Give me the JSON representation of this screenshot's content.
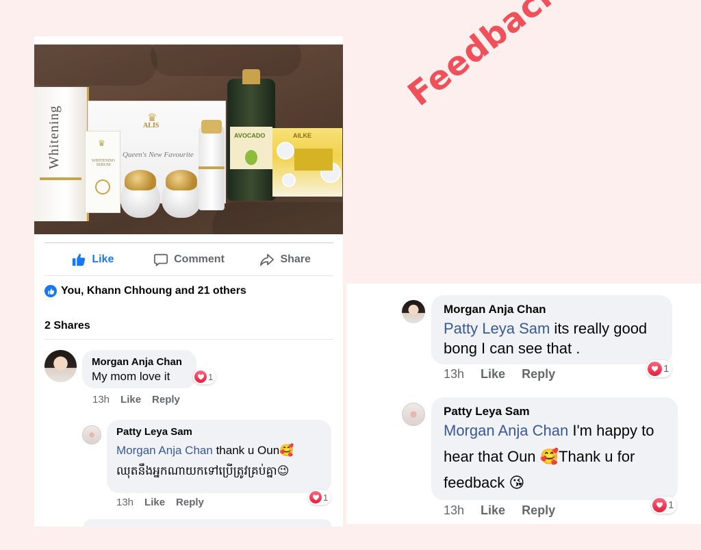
{
  "title": "Feedback",
  "post": {
    "photo": {
      "box_text": "Whitening",
      "gift_box_brand": "ALIS",
      "gift_box_script": "Queen's New Favourite",
      "serum_label": "WHITENING SERUM",
      "bottle_label": "AVOCADO",
      "soap_label": "AILKE"
    },
    "actions": {
      "like": "Like",
      "comment": "Comment",
      "share": "Share"
    },
    "reactions_text": "You, Khann Chhoung and 21 others",
    "shares_text": "2 Shares"
  },
  "comments": [
    {
      "name": "Morgan Anja Chan",
      "text": "My mom love it",
      "time": "13h",
      "like": "Like",
      "reply": "Reply",
      "reaction_count": "1"
    },
    {
      "name": "Patty Leya Sam",
      "mention": "Morgan Anja Chan",
      "text": "thank u Oun🥰",
      "text2": "ឈុតនឹងអ្នកណាយកទៅប្រើត្រូវគ្រប់គ្នា😉",
      "time": "13h",
      "like": "Like",
      "reply": "Reply",
      "reaction_count": "1"
    }
  ],
  "right_comments": [
    {
      "name": "Morgan Anja Chan",
      "mention": "Patty Leya Sam",
      "text": " its really good",
      "text2": "bong I can see that .",
      "time": "13h",
      "like": "Like",
      "reply": "Reply",
      "reaction_count": "1"
    },
    {
      "name": "Patty Leya Sam",
      "mention": "Morgan Anja Chan",
      "text": " I'm happy to",
      "text2": "hear that Oun 🥰Thank u for",
      "text3": "feedback 😘",
      "time": "13h",
      "like": "Like",
      "reply": "Reply",
      "reaction_count": "1"
    }
  ],
  "colors": {
    "background": "#fcefed",
    "feedback_title": "#f0505a",
    "facebook_blue": "#1877f2",
    "mention": "#385898",
    "heart": "#e61e3e"
  }
}
